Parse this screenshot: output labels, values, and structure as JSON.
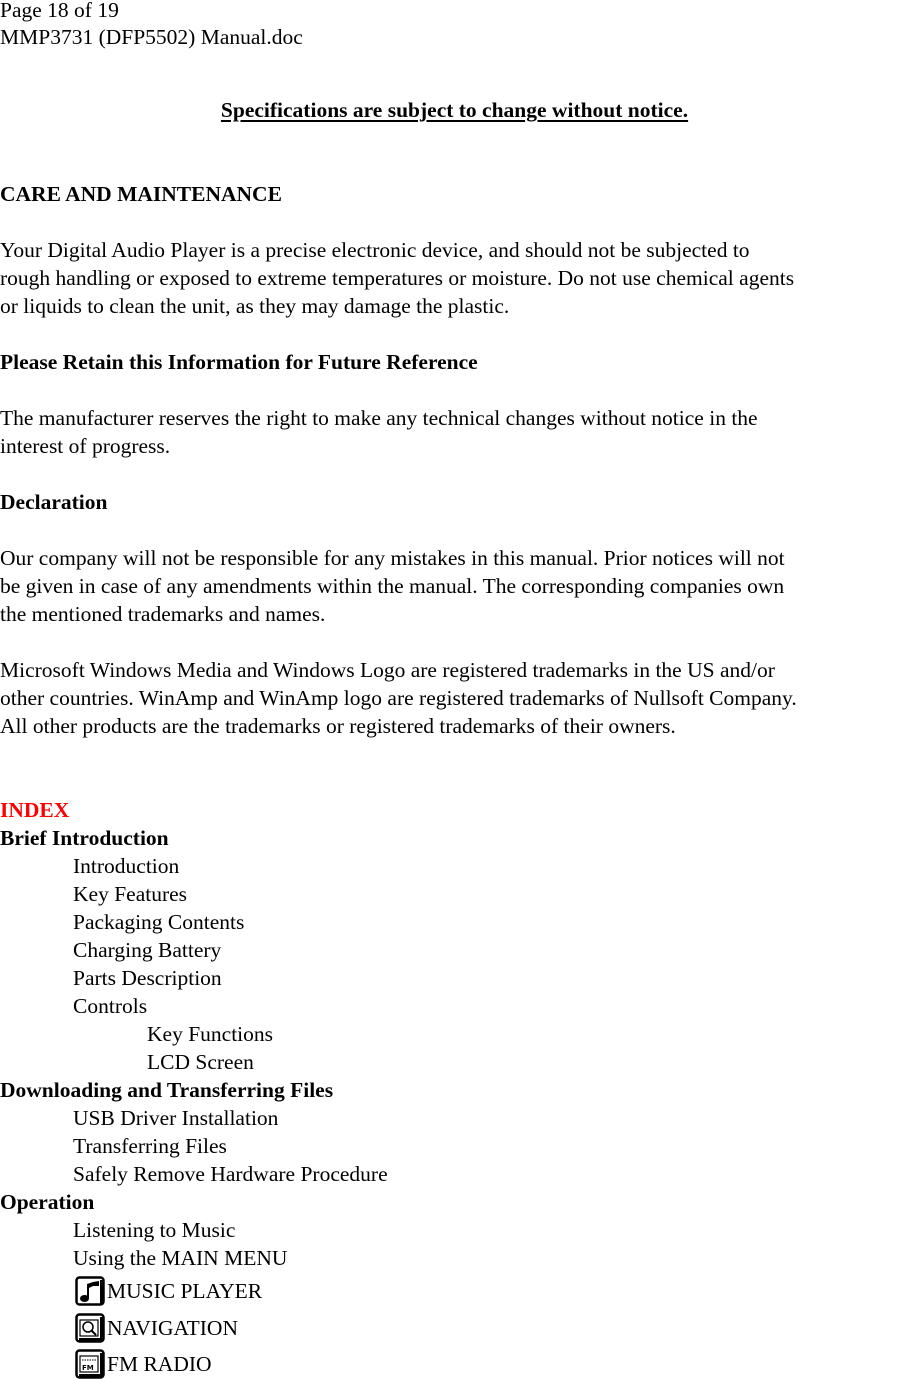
{
  "header": {
    "page_info": "Page 18 of 19",
    "filename": "MMP3731 (DFP5502) Manual.doc"
  },
  "notice": "Specifications are subject to change without notice.",
  "care": {
    "heading": "CARE AND MAINTENANCE",
    "lines": [
      "Your Digital Audio Player is a precise electronic device, and should not be subjected to",
      "rough handling or exposed to extreme temperatures or moisture.  Do not use chemical agents",
      "or liquids to clean the unit, as they may damage the plastic."
    ]
  },
  "retain": {
    "heading": "Please Retain this Information for Future Reference",
    "lines": [
      "The manufacturer reserves the right to make any technical changes without notice in the",
      "interest of progress."
    ]
  },
  "declaration": {
    "heading": "Declaration",
    "para1": [
      "Our company will not be responsible for any mistakes in this manual.  Prior notices will not",
      "be given in case of any amendments within the manual.  The corresponding companies own",
      "the mentioned trademarks and names."
    ],
    "para2": [
      "Microsoft Windows Media and Windows Logo are registered trademarks in the US and/or",
      "other countries.  WinAmp and WinAmp logo are registered trademarks of Nullsoft Company.",
      "All other products are the trademarks or registered trademarks of their owners."
    ]
  },
  "index": {
    "title": "INDEX",
    "title_color": "#ff0000",
    "sections": [
      {
        "title": "Brief Introduction",
        "items": [
          "Introduction",
          "Key Features",
          "Packaging Contents",
          "Charging Battery",
          "Parts Description",
          "Controls"
        ],
        "subitems": [
          "Key Functions",
          "LCD Screen"
        ]
      },
      {
        "title": "Downloading and Transferring Files",
        "items": [
          "USB Driver Installation",
          "Transferring Files",
          "Safely Remove Hardware Procedure"
        ]
      },
      {
        "title": "Operation",
        "items": [
          "Listening to Music",
          "Using the MAIN MENU"
        ],
        "menu_items": [
          {
            "label": "MUSIC PLAYER",
            "icon": "music-note-icon"
          },
          {
            "label": "NAVIGATION",
            "icon": "navigation-folder-icon"
          },
          {
            "label": "FM RADIO",
            "icon": "fm-radio-icon"
          }
        ]
      }
    ]
  }
}
